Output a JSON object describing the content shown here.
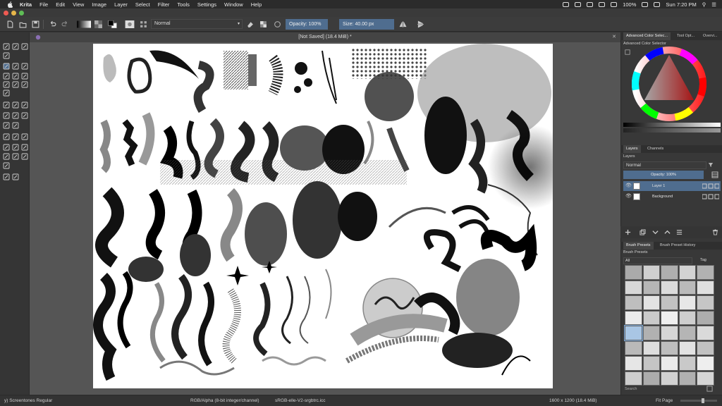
{
  "menubar": {
    "app_name": "Krita",
    "items": [
      "File",
      "Edit",
      "View",
      "Image",
      "Layer",
      "Select",
      "Filter",
      "Tools",
      "Settings",
      "Window",
      "Help"
    ],
    "battery": "100%",
    "clock": "Sun 7:20 PM"
  },
  "toolbar": {
    "blend_mode": "Normal",
    "opacity_label": "Opacity: 100%",
    "size_label": "Size: 40.00 px"
  },
  "document": {
    "tab_title": "[Not Saved]  (18.4 MiB) *"
  },
  "dock": {
    "color_tabs": [
      "Advanced Color Selec...",
      "Tool Opt...",
      "Overvi..."
    ],
    "color_title": "Advanced Color Selector",
    "layer_tabs": [
      "Layers",
      "Channels"
    ],
    "layers_title": "Layers",
    "layers_blend": "Normal",
    "layers_opacity": "Opacity:  100%",
    "layers": [
      {
        "name": "Layer 1"
      },
      {
        "name": "Background"
      }
    ],
    "brush_tabs": [
      "Brush Presets",
      "Brush Preset History"
    ],
    "brush_title": "Brush Presets",
    "brush_filter": "All",
    "brush_tag": "Tag",
    "search_placeholder": "Search"
  },
  "statusbar": {
    "brush_name": "y) Screentones Regular",
    "color_model": "RGB/Alpha (8-bit integer/channel)",
    "profile": "sRGB-elle-V2-srgbtrc.icc",
    "dimensions": "1600 x 1200 (18.4 MiB)",
    "zoom_mode": "Fit Page"
  },
  "colors": {
    "accent": "#4f6d8f",
    "canvas": "#ffffff",
    "workspace": "#555555"
  }
}
